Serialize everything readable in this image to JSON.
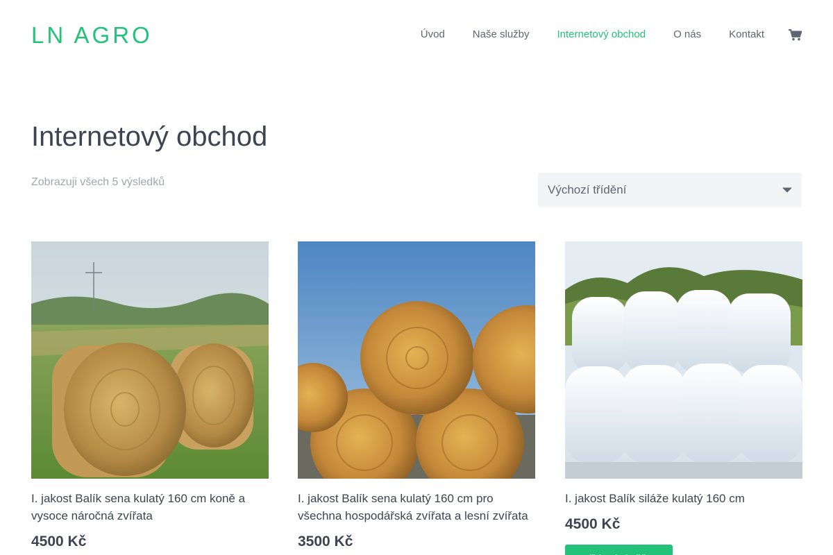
{
  "header": {
    "logo_text": "LN AGRO",
    "brand_color": "#23c27a",
    "nav": [
      {
        "label": "Úvod",
        "active": false
      },
      {
        "label": "Naše služby",
        "active": false
      },
      {
        "label": "Internetový obchod",
        "active": true
      },
      {
        "label": "O nás",
        "active": false
      },
      {
        "label": "Kontakt",
        "active": false
      }
    ],
    "cart_icon": "shopping-cart-icon"
  },
  "page": {
    "title": "Internetový obchod",
    "result_count": "Zobrazuji všech 5 výsledků",
    "sort": {
      "selected": "Výchozí třídění",
      "icon": "chevron-down-icon"
    }
  },
  "products": [
    {
      "name": "I. jakost Balík sena kulatý 160 cm koně a vysoce náročná zvířata",
      "price": "4500 Kč",
      "image": "hay-bales-field"
    },
    {
      "name": "I. jakost Balík sena kulatý 160 cm pro všechna hospodářská zvířata a lesní zvířata",
      "price": "3500 Kč",
      "image": "stacked-hay-bales"
    },
    {
      "name": "I. jakost Balík siláže kulatý 160 cm",
      "price": "4500 Kč",
      "image": "wrapped-silage-bales",
      "button": "Přidat do košíku"
    }
  ]
}
